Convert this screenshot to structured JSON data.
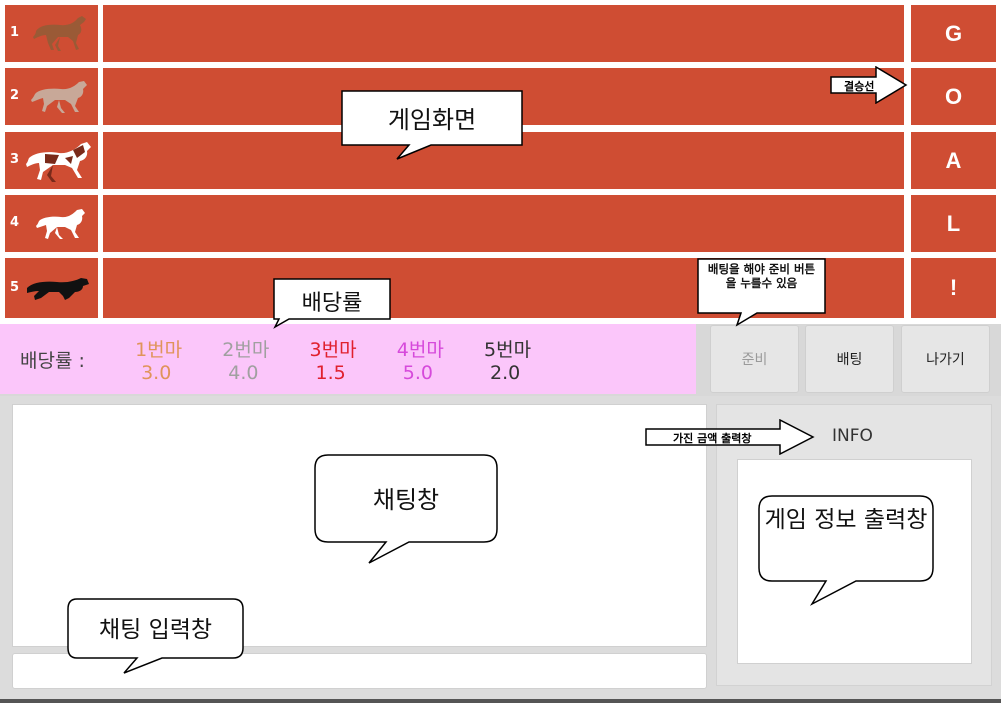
{
  "lanes": [
    {
      "num": "1"
    },
    {
      "num": "2"
    },
    {
      "num": "3"
    },
    {
      "num": "4"
    },
    {
      "num": "5"
    }
  ],
  "goal_letters": [
    "G",
    "O",
    "A",
    "L",
    "!"
  ],
  "odds": {
    "label": "배당률 :",
    "items": [
      {
        "name": "1번마",
        "value": "3.0",
        "color": "#e0945a"
      },
      {
        "name": "2번마",
        "value": "4.0",
        "color": "#a0a0a0"
      },
      {
        "name": "3번마",
        "value": "1.5",
        "color": "#e0202e"
      },
      {
        "name": "4번마",
        "value": "5.0",
        "color": "#d64adb"
      },
      {
        "name": "5번마",
        "value": "2.0",
        "color": "#333333"
      }
    ]
  },
  "buttons": {
    "ready": "준비",
    "bet": "배팅",
    "exit": "나가기"
  },
  "info": {
    "title": "INFO"
  },
  "annotations": {
    "game_screen": "게임화면",
    "finish_line": "결승선",
    "odds_rate": "배당률",
    "ready_note": "배팅을 해야 준비 버튼을 누를수 있음",
    "chat_window": "채팅창",
    "chat_input": "채팅 입력창",
    "money_output": "가진 금액 출력창",
    "game_info": "게임 정보 출력창"
  },
  "colors": {
    "track": "#cf4d33",
    "odds_bg": "#fbc6fa",
    "panel": "#e4e4e4"
  }
}
